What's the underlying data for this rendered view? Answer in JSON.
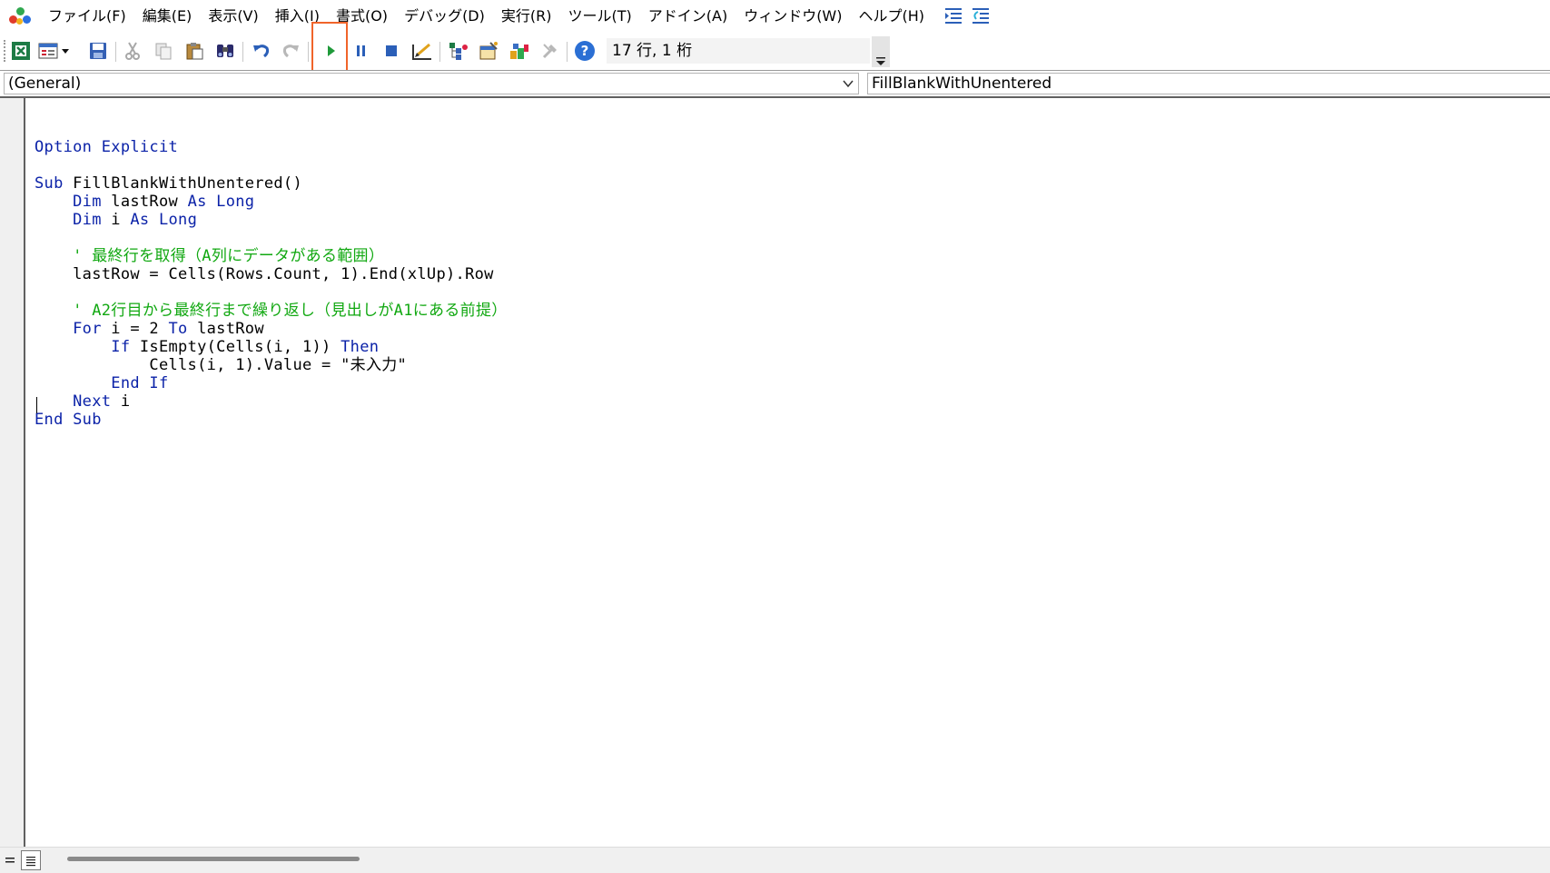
{
  "menu": {
    "items": [
      {
        "label": "ファイル(F)"
      },
      {
        "label": "編集(E)"
      },
      {
        "label": "表示(V)"
      },
      {
        "label": "挿入(I)"
      },
      {
        "label": "書式(O)"
      },
      {
        "label": "デバッグ(D)"
      },
      {
        "label": "実行(R)"
      },
      {
        "label": "ツール(T)"
      },
      {
        "label": "アドイン(A)"
      },
      {
        "label": "ウィンドウ(W)"
      },
      {
        "label": "ヘルプ(H)"
      }
    ]
  },
  "toolbar": {
    "status": "17 行, 1 桁",
    "highlighted_button": "run-sub-button"
  },
  "combos": {
    "object": "(General)",
    "procedure": "FillBlankWithUnentered"
  },
  "code": {
    "lines": [
      [
        {
          "t": "Option Explicit",
          "c": "kw"
        }
      ],
      [],
      [
        {
          "t": "Sub ",
          "c": "kw"
        },
        {
          "t": "FillBlankWithUnentered()",
          "c": "tx"
        }
      ],
      [
        {
          "t": "    "
        },
        {
          "t": "Dim ",
          "c": "kw"
        },
        {
          "t": "lastRow ",
          "c": "tx"
        },
        {
          "t": "As Long",
          "c": "kw"
        }
      ],
      [
        {
          "t": "    "
        },
        {
          "t": "Dim ",
          "c": "kw"
        },
        {
          "t": "i ",
          "c": "tx"
        },
        {
          "t": "As Long",
          "c": "kw"
        }
      ],
      [],
      [
        {
          "t": "    "
        },
        {
          "t": "' 最終行を取得（A列にデータがある範囲）",
          "c": "cm"
        }
      ],
      [
        {
          "t": "    "
        },
        {
          "t": "lastRow = Cells(Rows.Count, 1).End(xlUp).Row",
          "c": "tx"
        }
      ],
      [],
      [
        {
          "t": "    "
        },
        {
          "t": "' A2行目から最終行まで繰り返し（見出しがA1にある前提）",
          "c": "cm"
        }
      ],
      [
        {
          "t": "    "
        },
        {
          "t": "For ",
          "c": "kw"
        },
        {
          "t": "i = 2 ",
          "c": "tx"
        },
        {
          "t": "To ",
          "c": "kw"
        },
        {
          "t": "lastRow",
          "c": "tx"
        }
      ],
      [
        {
          "t": "        "
        },
        {
          "t": "If ",
          "c": "kw"
        },
        {
          "t": "IsEmpty(Cells(i, 1)) ",
          "c": "tx"
        },
        {
          "t": "Then",
          "c": "kw"
        }
      ],
      [
        {
          "t": "            "
        },
        {
          "t": "Cells(i, 1).Value = \"未入力\"",
          "c": "tx"
        }
      ],
      [
        {
          "t": "        "
        },
        {
          "t": "End If",
          "c": "kw"
        }
      ],
      [
        {
          "t": "    "
        },
        {
          "t": "Next ",
          "c": "kw"
        },
        {
          "t": "i",
          "c": "tx"
        }
      ],
      [
        {
          "t": "End Sub",
          "c": "kw"
        }
      ],
      []
    ]
  },
  "colors": {
    "keyword": "#0b22a8",
    "comment": "#11a811",
    "highlight": "#f0642a"
  }
}
